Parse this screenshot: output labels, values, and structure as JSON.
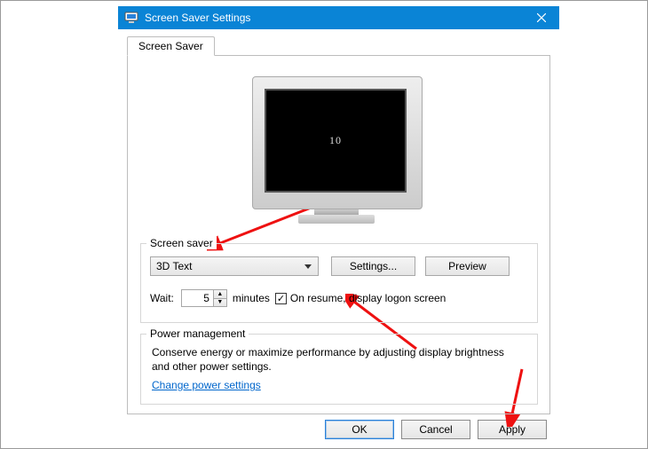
{
  "window": {
    "title": "Screen Saver Settings",
    "close_label": "Close"
  },
  "tab": {
    "label": "Screen Saver"
  },
  "preview_text": "10",
  "screensaver_group": {
    "legend": "Screen saver",
    "dropdown_value": "3D Text",
    "settings_label": "Settings...",
    "preview_label": "Preview",
    "wait_label": "Wait:",
    "wait_value": "5",
    "minutes_label": "minutes",
    "resume_checked": true,
    "resume_label": "On resume, display logon screen"
  },
  "power_group": {
    "legend": "Power management",
    "text": "Conserve energy or maximize performance by adjusting display brightness and other power settings.",
    "link": "Change power settings"
  },
  "buttons": {
    "ok": "OK",
    "cancel": "Cancel",
    "apply": "Apply"
  }
}
